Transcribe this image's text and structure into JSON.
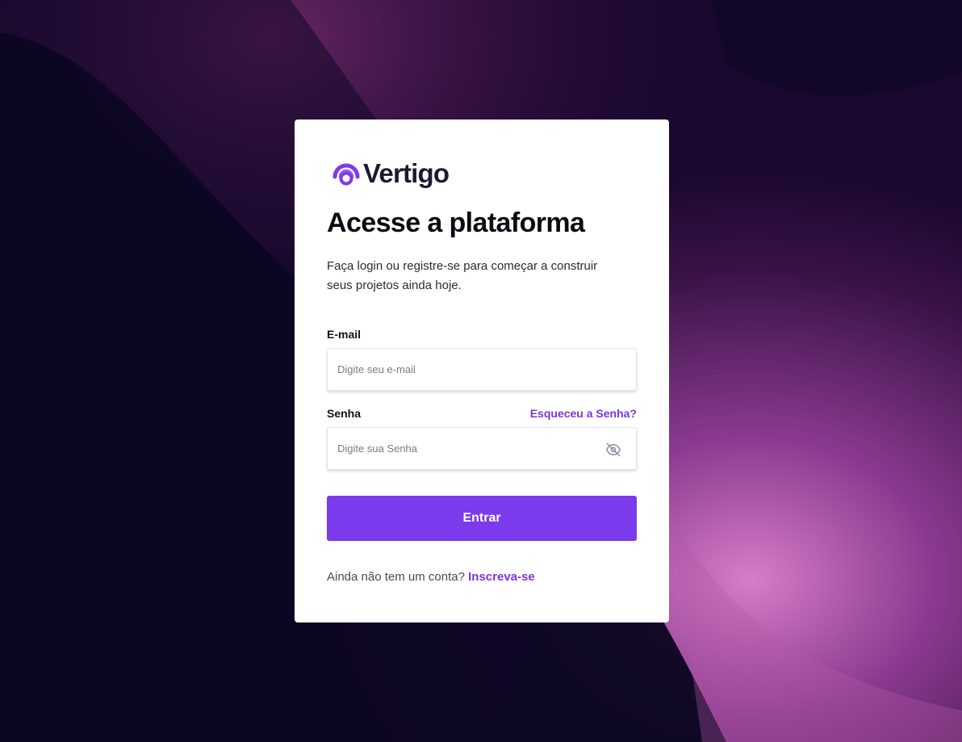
{
  "brand": {
    "name": "Vertigo",
    "accent": "#7c3aed",
    "icon": "vertigo-logo-icon"
  },
  "title": "Acesse a plataforma",
  "subtitle": "Faça login ou registre-se para começar a construir seus projetos ainda hoje.",
  "email": {
    "label": "E-mail",
    "placeholder": "Digite seu e-mail",
    "value": ""
  },
  "password": {
    "label": "Senha",
    "placeholder": "Digite sua Senha",
    "value": "",
    "forgot_label": "Esqueceu a Senha?",
    "toggle_icon": "eye-off-icon"
  },
  "submit_label": "Entrar",
  "signup": {
    "prompt": "Ainda não tem um conta?",
    "link_label": "Inscreva-se"
  }
}
